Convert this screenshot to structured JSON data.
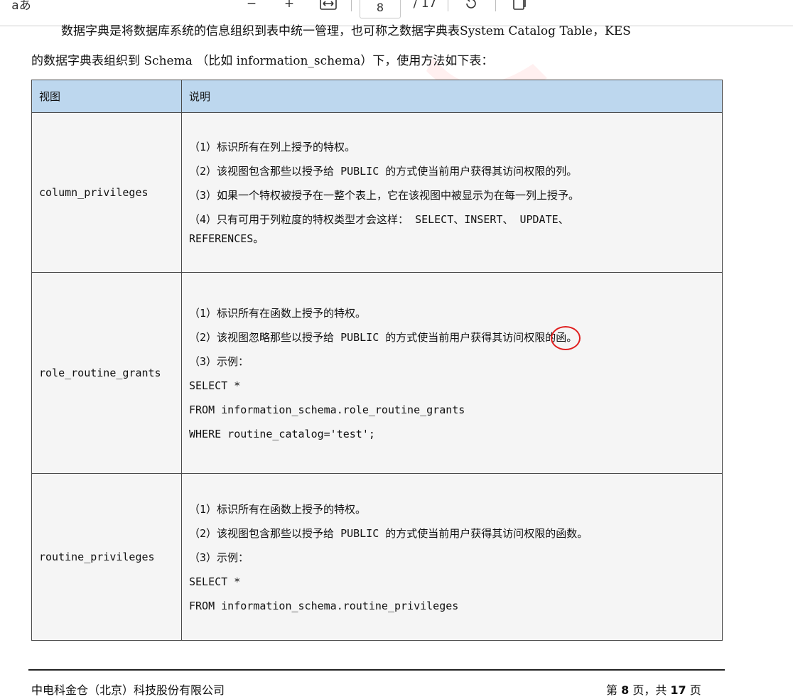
{
  "toolbar": {
    "left_label": "aあ",
    "zoom_out": "−",
    "zoom_in": "+",
    "current_page": "8",
    "total_pages": "/ 17"
  },
  "intro": {
    "line1": "数据字典是将数据库系统的信息组织到表中统一管理，也可称之数据字典表System Catalog Table，KES",
    "line2": "的数据字典表组织到 Schema （比如 information_schema）下，使用方法如下表："
  },
  "table": {
    "headers": [
      "视图",
      "说明"
    ],
    "rows": [
      {
        "view": "column_privileges",
        "lines": [
          "（1）标识所有在列上授予的特权。",
          "（2）该视图包含那些以授予给 PUBLIC 的方式使当前用户获得其访问权限的列。",
          "（3）如果一个特权被授予在一整个表上，它在该视图中被显示为在每一列上授予。",
          "（4）只有可用于列粒度的特权类型才会这样： SELECT、INSERT、 UPDATE、",
          "REFERENCES。"
        ]
      },
      {
        "view": "role_routine_grants",
        "lines": [
          "（1）标识所有在函数上授予的特权。",
          "（2）该视图忽略那些以授予给 PUBLIC 的方式使当前用户获得其访问权限的",
          "（3）示例：",
          "SELECT *",
          "FROM information_schema.role_routine_grants",
          "WHERE routine_catalog='test';"
        ],
        "circled_text": "函。"
      },
      {
        "view": "routine_privileges",
        "lines": [
          "（1）标识所有在函数上授予的特权。",
          "（2）该视图包含那些以授予给 PUBLIC 的方式使当前用户获得其访问权限的函数。",
          "（3）示例：",
          "SELECT *",
          "FROM information_schema.routine_privileges"
        ]
      }
    ]
  },
  "footer": {
    "company": "中电科金仓（北京）科技股份有限公司",
    "page_prefix": "第 ",
    "page_num": "8",
    "page_mid": " 页，共 ",
    "page_total": "17",
    "page_suffix": " 页"
  }
}
